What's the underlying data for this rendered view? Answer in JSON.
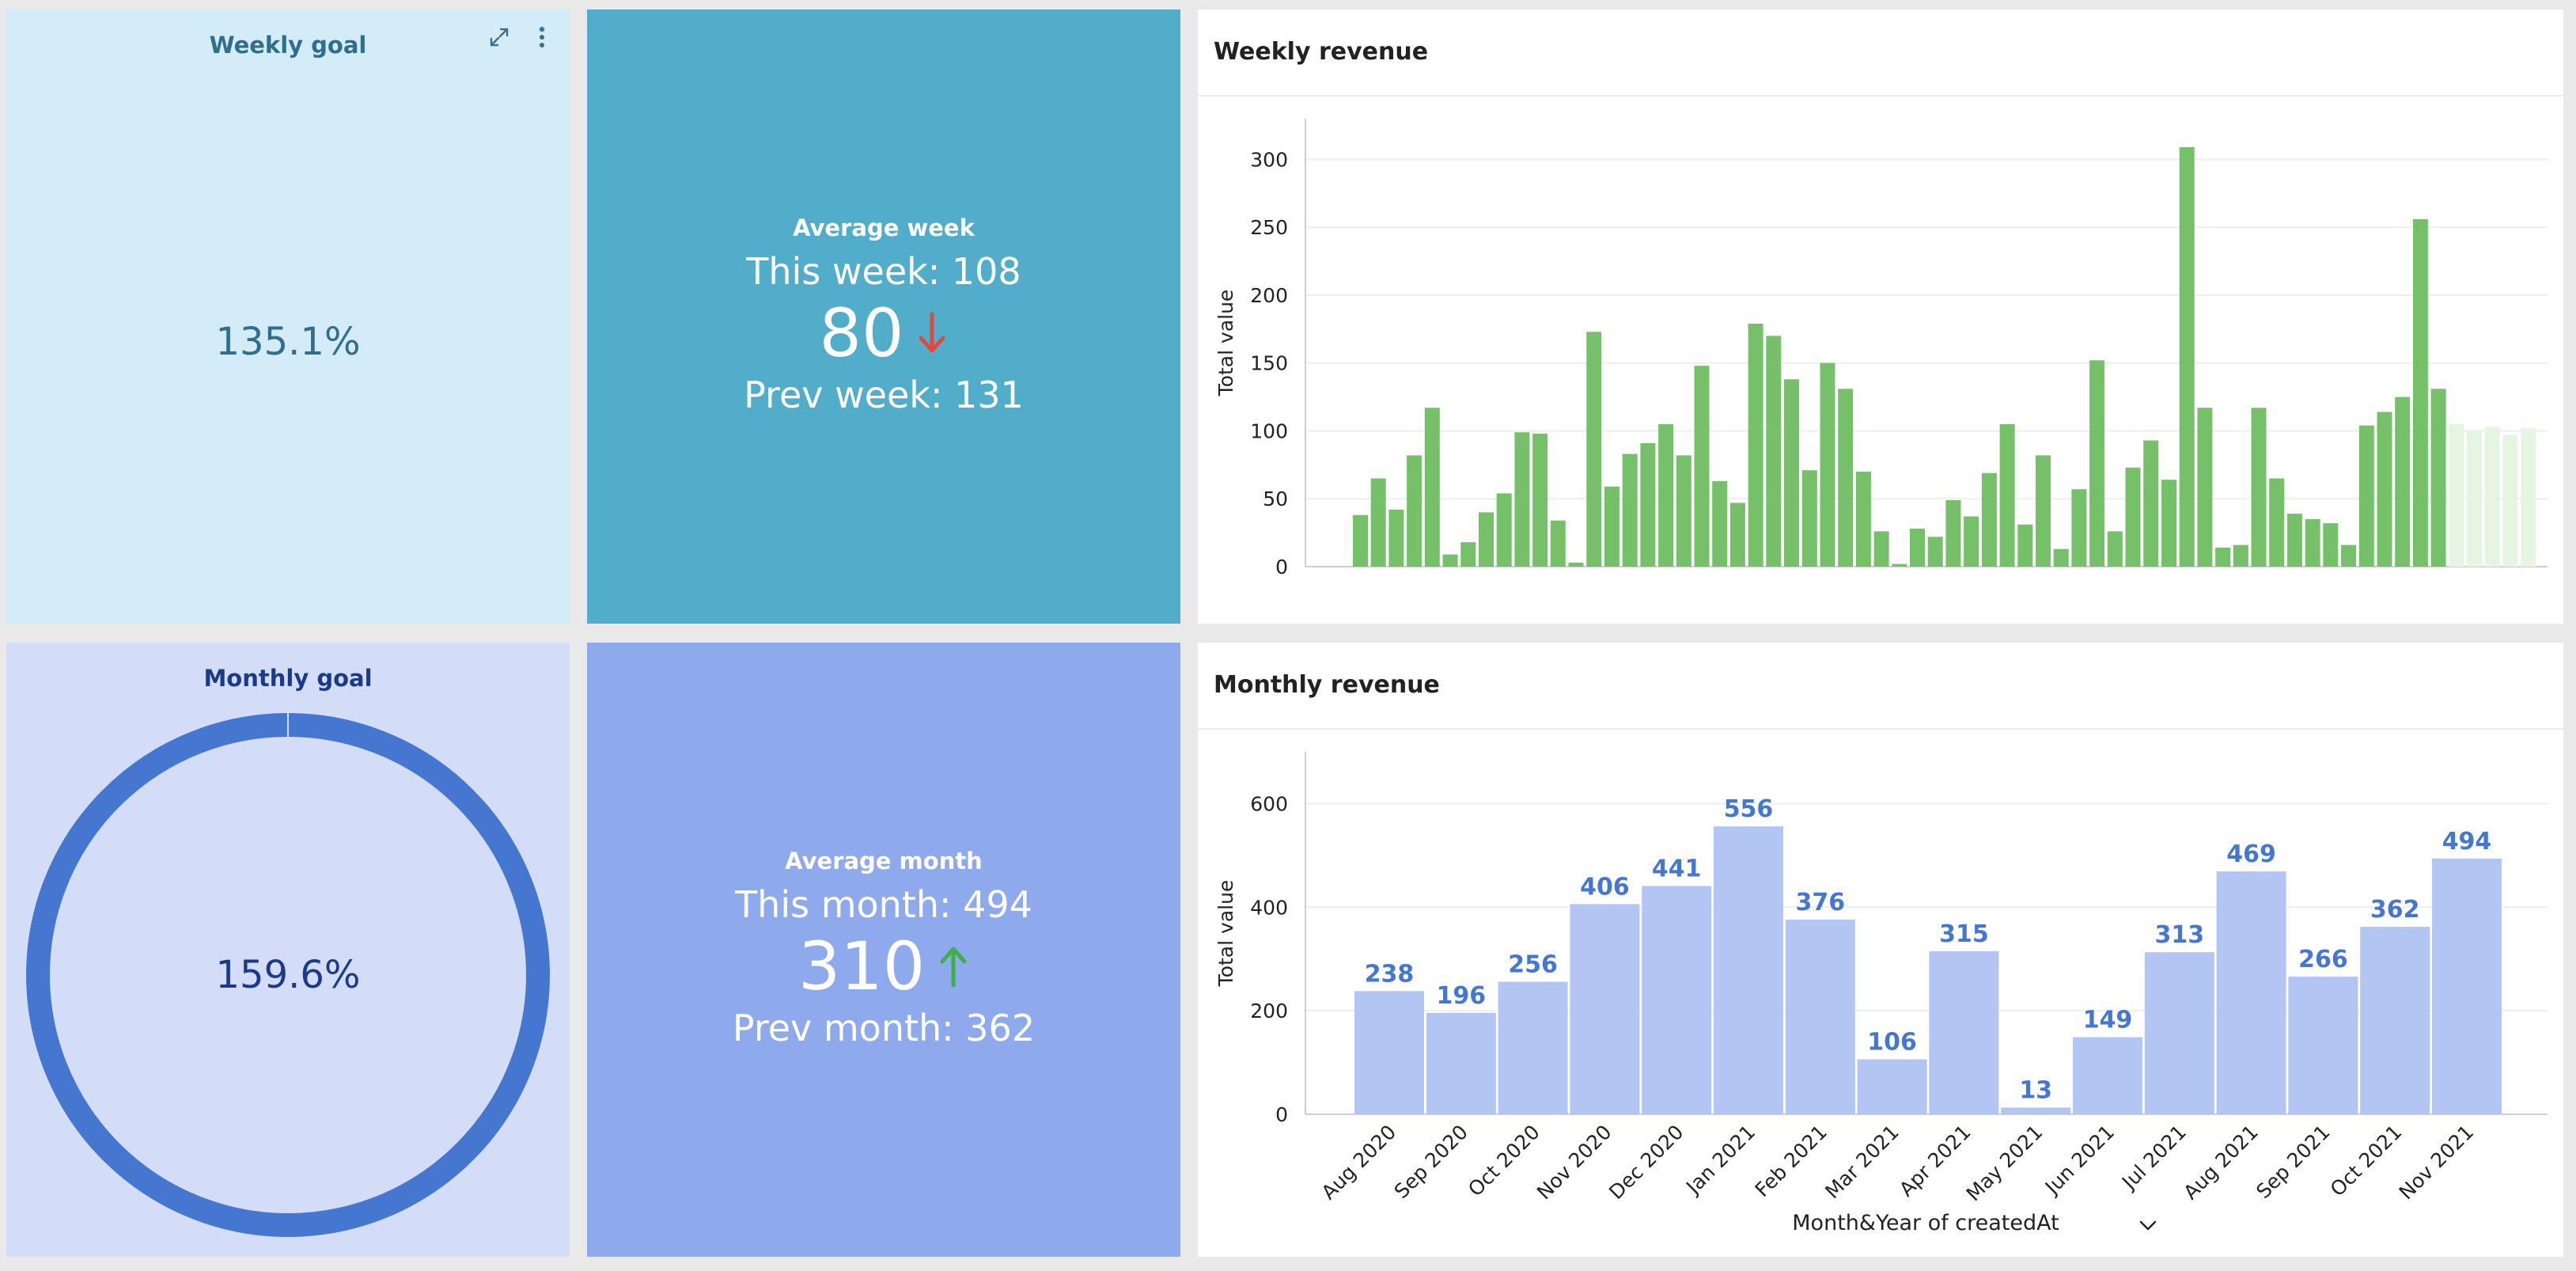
{
  "weekly_goal": {
    "title": "Weekly goal",
    "value_label": "135.1%",
    "progress": 1.351,
    "ring_color": "#4fb0cc",
    "text_color": "#2f6e8c",
    "tools": {
      "expand_icon": "expand-icon",
      "menu_icon": "more-vertical-icon"
    }
  },
  "weekly_avg": {
    "title": "Average week",
    "current_label": "This week: 108",
    "value": "80",
    "trend": "down",
    "trend_color": "#e0473e",
    "previous_label": "Prev week: 131"
  },
  "monthly_goal": {
    "title": "Monthly goal",
    "value_label": "159.6%",
    "progress": 1.596,
    "ring_color": "#4677d0",
    "text_color": "#1c3a8a"
  },
  "monthly_avg": {
    "title": "Average month",
    "current_label": "This month: 494",
    "value": "310",
    "trend": "up",
    "trend_color": "#3fae49",
    "previous_label": "Prev month: 362"
  },
  "chart_data": [
    {
      "type": "bar",
      "title": "Weekly revenue",
      "ylabel": "Total value",
      "xlabel": "",
      "ylim": [
        0,
        330
      ],
      "yticks": [
        0,
        50,
        100,
        150,
        200,
        250,
        300
      ],
      "color": "#76c06a",
      "faded_color": "#e6f4e2",
      "values": [
        38,
        65,
        42,
        82,
        117,
        9,
        18,
        40,
        54,
        99,
        98,
        34,
        3,
        173,
        59,
        83,
        91,
        105,
        82,
        148,
        63,
        47,
        179,
        170,
        138,
        71,
        150,
        131,
        70,
        26,
        2,
        28,
        22,
        49,
        37,
        69,
        105,
        31,
        82,
        13,
        57,
        152,
        26,
        73,
        93,
        64,
        309,
        117,
        14,
        16,
        117,
        65,
        39,
        35,
        32,
        16,
        104,
        114,
        125,
        256,
        131
      ],
      "faded_values": [
        105,
        100,
        103,
        97,
        102
      ],
      "grid": true
    },
    {
      "type": "bar",
      "title": "Monthly revenue",
      "ylabel": "Total value",
      "xlabel": "Month&Year of createdAt",
      "ylim": [
        0,
        700
      ],
      "yticks": [
        0,
        200,
        400,
        600
      ],
      "color": "#b3c5f3",
      "label_color": "#4677d0",
      "categories": [
        "Aug 2020",
        "Sep 2020",
        "Oct 2020",
        "Nov 2020",
        "Dec 2020",
        "Jan 2021",
        "Feb 2021",
        "Mar 2021",
        "Apr 2021",
        "May 2021",
        "Jun 2021",
        "Jul 2021",
        "Aug 2021",
        "Sep 2021",
        "Oct 2021",
        "Nov 2021"
      ],
      "values": [
        238,
        196,
        256,
        406,
        441,
        556,
        376,
        106,
        315,
        13,
        149,
        313,
        469,
        266,
        362,
        494
      ],
      "grid": true
    }
  ]
}
